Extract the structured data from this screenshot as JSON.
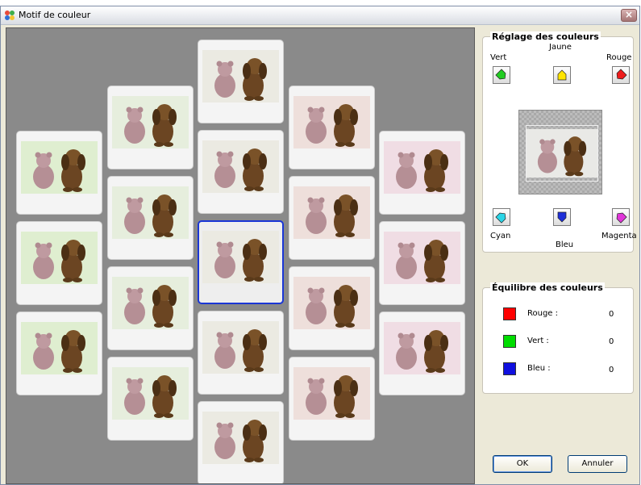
{
  "window": {
    "title": "Motif de couleur",
    "close_symbol": "×"
  },
  "grid": {
    "selected": "c3r3",
    "columns": [
      {
        "id": "c1",
        "rows": 3,
        "tint": "#dfeed0"
      },
      {
        "id": "c2",
        "rows": 4,
        "tint": "#e6eedd"
      },
      {
        "id": "c3",
        "rows": 5,
        "tint": "#ebeae2"
      },
      {
        "id": "c4",
        "rows": 4,
        "tint": "#eedfdb"
      },
      {
        "id": "c5",
        "rows": 3,
        "tint": "#f0dde4"
      }
    ]
  },
  "adjust": {
    "title": "Réglage des couleurs",
    "labels": {
      "vert": "Vert",
      "jaune": "Jaune",
      "rouge": "Rouge",
      "cyan": "Cyan",
      "bleu": "Bleu",
      "magenta": "Magenta"
    },
    "colors": {
      "vert": "#22cc22",
      "jaune": "#ffe400",
      "rouge": "#ee1c1c",
      "cyan": "#2ad4e6",
      "bleu": "#1e2fd8",
      "magenta": "#e036d8"
    }
  },
  "balance": {
    "title": "Équilibre des couleurs",
    "items": [
      {
        "label": "Rouge :",
        "value": "0",
        "color": "#ff0000"
      },
      {
        "label": "Vert :",
        "value": "0",
        "color": "#00dd00"
      },
      {
        "label": "Bleu :",
        "value": "0",
        "color": "#1010e0"
      }
    ]
  },
  "buttons": {
    "ok": "OK",
    "cancel": "Annuler"
  }
}
